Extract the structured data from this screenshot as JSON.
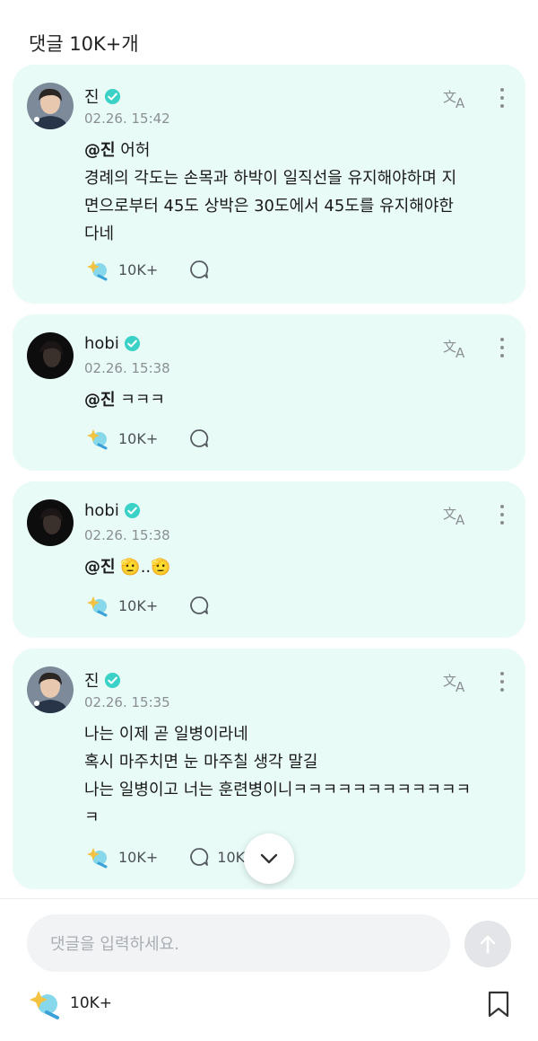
{
  "header": {
    "title": "댓글 10K+개"
  },
  "colors": {
    "card_bg": "#e9fbf7",
    "verified": "#3ad1c6",
    "meta": "#8a8f94"
  },
  "comments": [
    {
      "name": "진",
      "time": "02.26. 15:42",
      "mention": "@진",
      "lines": [
        "어허",
        "경례의 각도는 손목과 하박이 일직선을 유지해야하며 지",
        "면으로부터 45도 상박은 30도에서 45도를 유지해야한",
        "다네"
      ],
      "cheer_count": "10K+",
      "reply_count": ""
    },
    {
      "name": "hobi",
      "time": "02.26. 15:38",
      "mention": "@진",
      "lines": [
        "ㅋㅋㅋ"
      ],
      "cheer_count": "10K+",
      "reply_count": ""
    },
    {
      "name": "hobi",
      "time": "02.26. 15:38",
      "mention": "@진",
      "lines": [
        "🫡..🫡"
      ],
      "cheer_count": "10K+",
      "reply_count": ""
    },
    {
      "name": "진",
      "time": "02.26. 15:35",
      "mention": "",
      "lines": [
        "나는 이제 곧 일병이라네",
        "혹시 마주치면 눈 마주칠 생각 말길",
        "나는 일병이고 너는 훈련병이니ㅋㅋㅋㅋㅋㅋㅋㅋㅋㅋㅋㅋ",
        "ㅋ"
      ],
      "cheer_count": "10K+",
      "reply_count": "10K+"
    }
  ],
  "input": {
    "placeholder": "댓글을 입력하세요."
  },
  "footer": {
    "cheer_count": "10K+"
  }
}
